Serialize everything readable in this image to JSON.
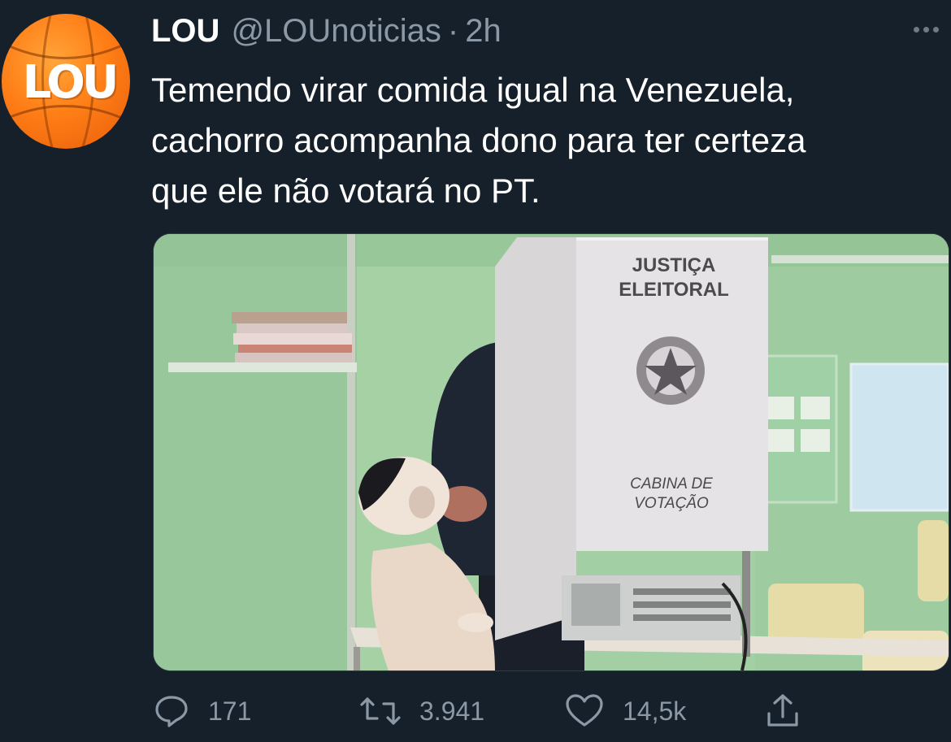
{
  "tweet": {
    "display_name": "LOU",
    "handle": "@LOUnoticias",
    "separator": "·",
    "time": "2h",
    "avatar_text": "LOU",
    "text": "Temendo virar comida igual na Venezuela,\ncachorro acompanha dono para ter certeza\nque ele não votará no PT.",
    "more_icon": "more-horizontal-icon"
  },
  "media": {
    "booth_title_line1": "JUSTIÇA",
    "booth_title_line2": "ELEITORAL",
    "booth_caption_line1": "CABINA DE",
    "booth_caption_line2": "VOTAÇÃO"
  },
  "actions": {
    "reply": {
      "icon": "reply-icon",
      "count": "171"
    },
    "retweet": {
      "icon": "retweet-icon",
      "count": "3.941"
    },
    "like": {
      "icon": "heart-icon",
      "count": "14,5k"
    },
    "share": {
      "icon": "share-icon"
    }
  },
  "colors": {
    "background": "#15202b",
    "secondary_text": "#8b98a5",
    "avatar_orange": "#ff7f17"
  }
}
